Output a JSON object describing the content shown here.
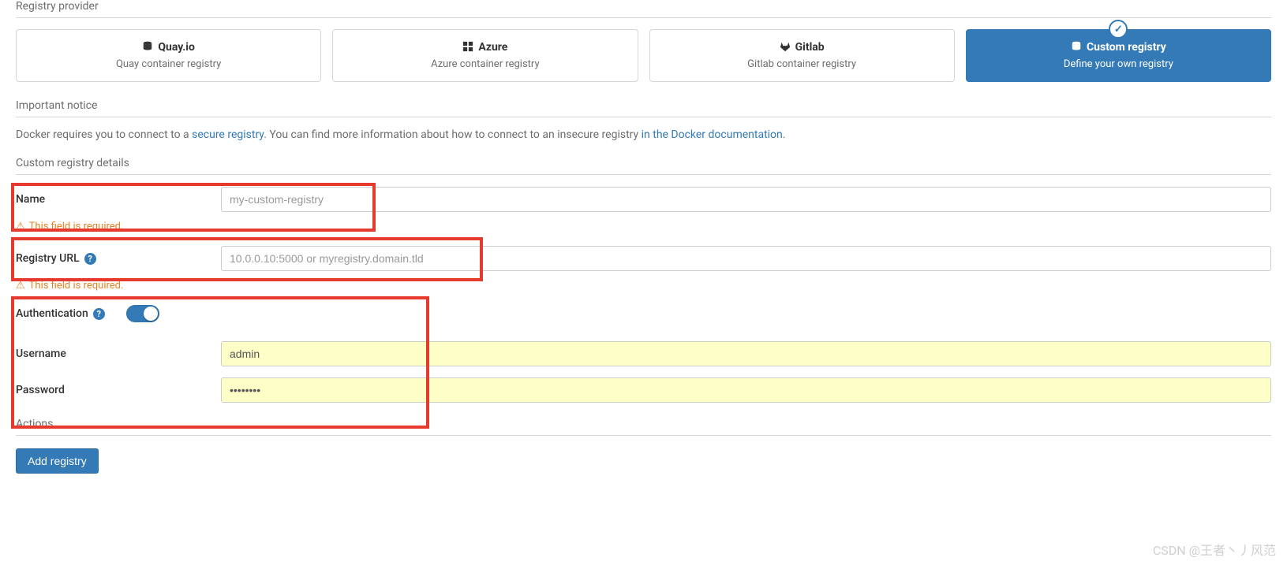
{
  "sections": {
    "provider_header": "Registry provider",
    "notice_header": "Important notice",
    "details_header": "Custom registry details",
    "actions_header": "Actions"
  },
  "providers": [
    {
      "title": "Quay.io",
      "subtitle": "Quay container registry"
    },
    {
      "title": "Azure",
      "subtitle": "Azure container registry"
    },
    {
      "title": "Gitlab",
      "subtitle": "Gitlab container registry"
    },
    {
      "title": "Custom registry",
      "subtitle": "Define your own registry"
    }
  ],
  "notice": {
    "pre": "Docker requires you to connect to a ",
    "link1": "secure registry",
    "mid": ". You can find more information about how to connect to an insecure registry ",
    "link2": "in the Docker documentation",
    "post": "."
  },
  "fields": {
    "name": {
      "label": "Name",
      "placeholder": "my-custom-registry",
      "value": "",
      "error": "This field is required."
    },
    "url": {
      "label": "Registry URL",
      "placeholder": "10.0.0.10:5000 or myregistry.domain.tld",
      "value": "",
      "error": "This field is required."
    },
    "auth": {
      "label": "Authentication",
      "on": true
    },
    "username": {
      "label": "Username",
      "value": "admin"
    },
    "password": {
      "label": "Password",
      "value": "••••••••"
    }
  },
  "buttons": {
    "add": "Add registry"
  },
  "watermark": "CSDN @王者丶丿风范"
}
